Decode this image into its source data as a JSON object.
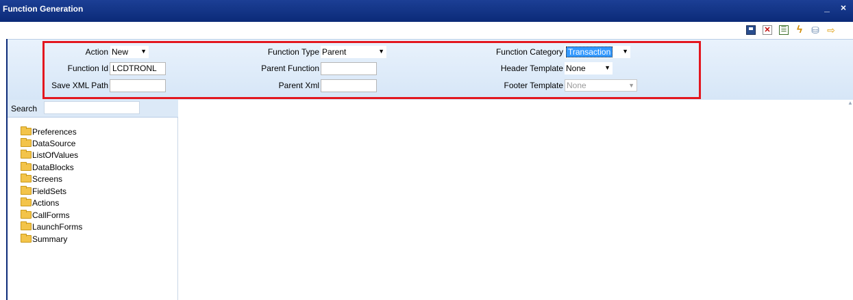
{
  "window": {
    "title": "Function Generation",
    "controls": "_ ×"
  },
  "toolbar": {
    "save_icon": "save-icon",
    "close_icon": "close-icon",
    "list_icon": "list-icon",
    "generate_icon": "generate-icon",
    "deploy_icon": "deploy-icon",
    "exit_icon": "exit-icon"
  },
  "form": {
    "action": {
      "label": "Action",
      "value": "New"
    },
    "function_id": {
      "label": "Function Id",
      "value": "LCDTRONL"
    },
    "save_xml_path": {
      "label": "Save XML Path",
      "value": ""
    },
    "function_type": {
      "label": "Function Type",
      "value": "Parent"
    },
    "parent_function": {
      "label": "Parent Function",
      "value": ""
    },
    "parent_xml": {
      "label": "Parent Xml",
      "value": ""
    },
    "function_category": {
      "label": "Function Category",
      "value": "Transaction"
    },
    "header_template": {
      "label": "Header Template",
      "value": "None"
    },
    "footer_template": {
      "label": "Footer Template",
      "value": "None"
    }
  },
  "search": {
    "label": "Search",
    "value": ""
  },
  "tree": {
    "items": [
      "Preferences",
      "DataSource",
      "ListOfValues",
      "DataBlocks",
      "Screens",
      "FieldSets",
      "Actions",
      "CallForms",
      "LaunchForms",
      "Summary"
    ]
  },
  "colors": {
    "title_bar": "#0b2a78",
    "highlight": "#e3161e",
    "panel": "#d6e6f7"
  }
}
